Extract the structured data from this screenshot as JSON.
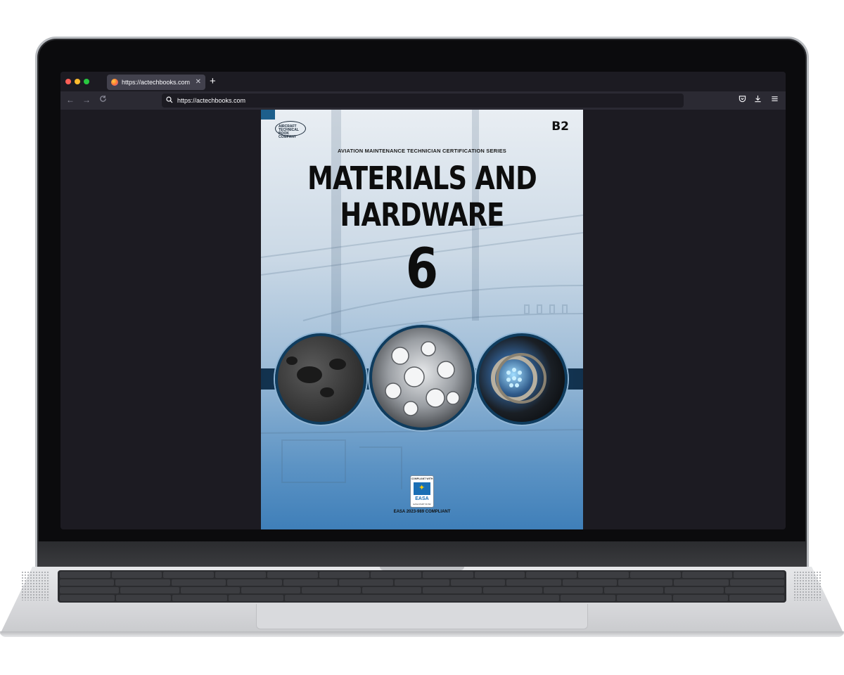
{
  "browser": {
    "tab_title": "https://actechbooks.com",
    "new_tab_icon": "+",
    "url": "https://actechbooks.com",
    "icons": [
      "back-arrow-icon",
      "forward-arrow-icon",
      "reload-icon",
      "search-icon",
      "pocket-icon",
      "download-icon",
      "menu-icon"
    ]
  },
  "cover": {
    "publisher_logo": "AIRCRAFT TECHNICAL BOOK COMPANY",
    "category": "B2",
    "series": "AVIATION MAINTENANCE TECHNICIAN CERTIFICATION SERIES",
    "title_line1": "MATERIALS AND",
    "title_line2": "HARDWARE",
    "module_number": "6",
    "badge": {
      "top": "COMPLIANT WITH",
      "label": "EASA",
      "sub": "EASA PART 66 B2"
    },
    "compliance": "EASA 2023-989 COMPLIANT"
  },
  "colors": {
    "accent_blue": "#1b6fb5",
    "band": "#174a72"
  }
}
